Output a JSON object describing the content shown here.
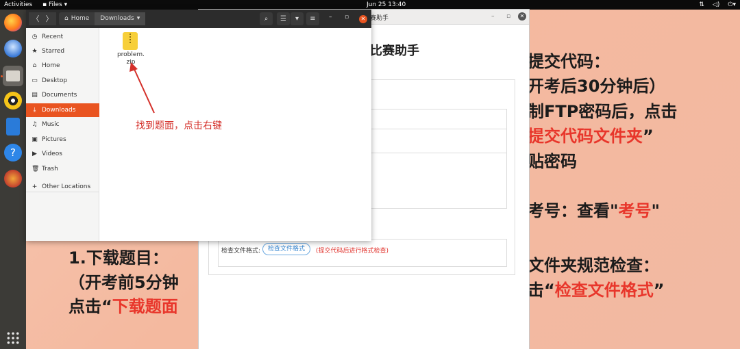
{
  "topbar": {
    "activities": "Activities",
    "app_menu": "Files",
    "clock": "Jun 25  13:40",
    "tray": [
      "network-icon",
      "volume-icon",
      "power-icon"
    ]
  },
  "dock": {
    "apps": [
      "firefox-icon",
      "thunderbird-icon",
      "files-icon",
      "rhythmbox-icon",
      "writer-icon",
      "help-icon",
      "app-icon"
    ],
    "show_apps": "grid-icon"
  },
  "slide_text": {
    "left_line1": "1.下载题目：",
    "left_line2": "（开考前5分钟",
    "left_line3_a": "点击“",
    "left_line3_b": "下载题面",
    "right_line1": "提交代码：",
    "right_line2": "开考后30分钟后）",
    "right_line3": "制FTP密码后，点击",
    "right_line4_a": "提交代码文件夹",
    "right_line4_b": "”",
    "right_line5": "贴密码",
    "right_line6_a": "考号：查看\"",
    "right_line6_b": "考号",
    "right_line6_c": "\"",
    "right_line7": "文件夹规范检查：",
    "right_line8_a": "击“",
    "right_line8_b": "检查文件格式",
    "right_line8_c": "”"
  },
  "assistant": {
    "window_title": "赛助手",
    "heading": "比赛助手",
    "check_label": "检查文件格式:",
    "check_button": "检查文件格式",
    "check_hint": "(提交代码后进行格式检查)"
  },
  "files": {
    "breadcrumb": {
      "home": "Home",
      "current": "Downloads"
    },
    "sidebar": [
      {
        "icon": "clock-icon",
        "label": "Recent"
      },
      {
        "icon": "star-icon",
        "label": "Starred"
      },
      {
        "icon": "home-icon",
        "label": "Home"
      },
      {
        "icon": "desktop-icon",
        "label": "Desktop"
      },
      {
        "icon": "document-icon",
        "label": "Documents"
      },
      {
        "icon": "download-icon",
        "label": "Downloads",
        "active": true
      },
      {
        "icon": "music-icon",
        "label": "Music"
      },
      {
        "icon": "picture-icon",
        "label": "Pictures"
      },
      {
        "icon": "video-icon",
        "label": "Videos"
      },
      {
        "icon": "trash-icon",
        "label": "Trash"
      },
      {
        "icon": "plus-icon",
        "label": "Other Locations"
      }
    ],
    "file": {
      "name_line1": "problem.",
      "name_line2": "zip"
    },
    "annotation": "找到题面，点击右键",
    "accent": "#e95420"
  }
}
